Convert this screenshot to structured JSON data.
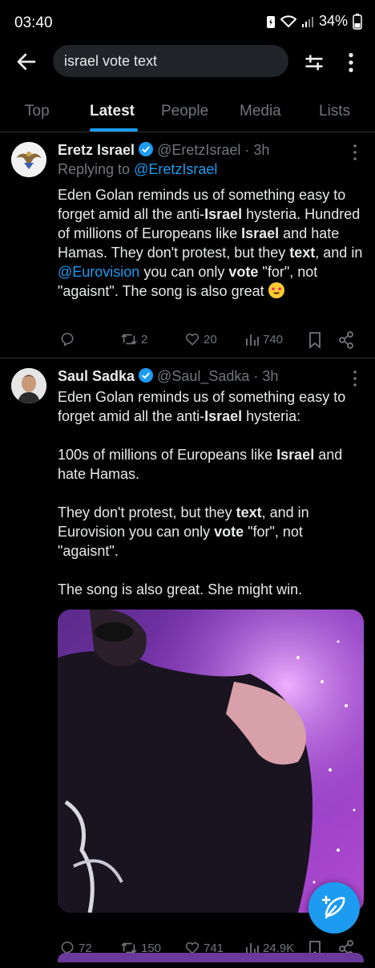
{
  "status_bar": {
    "time": "03:40",
    "battery": "34%"
  },
  "search": {
    "query": "israel vote text"
  },
  "tabs": [
    {
      "label": "Top"
    },
    {
      "label": "Latest"
    },
    {
      "label": "People"
    },
    {
      "label": "Media"
    },
    {
      "label": "Lists"
    }
  ],
  "active_tab": "Latest",
  "tweets": [
    {
      "name": "Eretz Israel",
      "handle": "@EretzIsrael",
      "time": "3h",
      "reply_prefix": "Replying to",
      "reply_handle": "@EretzIsrael",
      "body": {
        "t1": "Eden Golan reminds us of something easy to forget amid all the anti-",
        "b1": "Israel",
        "t2": " hysteria. Hundred of millions of Europeans like ",
        "b2": "Israel",
        "t3": " and hate Hamas. They don't protest, but they ",
        "b3": "text",
        "t4": ", and in ",
        "link": "@Eurovision",
        "t5": " you can only ",
        "b4": "vote",
        "t6": " \"for\", not \"agaisnt\". The song is also great "
      },
      "stats": {
        "reposts": "2",
        "likes": "20",
        "views": "740"
      }
    },
    {
      "name": "Saul Sadka",
      "handle": "@Saul_Sadka",
      "time": "3h",
      "body": {
        "p1a": "Eden Golan reminds us of something easy to forget amid all the anti-",
        "p1b": "Israel",
        "p1c": " hysteria:",
        "p2a": "100s of millions of Europeans like ",
        "p2b": "Israel",
        "p2c": " and hate Hamas.",
        "p3a": "They don't protest, but they ",
        "p3b": "text",
        "p3c": ", and in Eurovision you can only ",
        "p3d": "vote",
        "p3e": " \"for\", not \"agaisnt\".",
        "p4": "The song is also great. She might win."
      },
      "stats": {
        "replies": "72",
        "reposts": "150",
        "likes": "741",
        "views": "24.9K"
      }
    }
  ],
  "colors": {
    "accent": "#1d9bf0",
    "background": "#000000",
    "muted": "#71767b",
    "text": "#e7e9ea"
  },
  "icons": [
    "back-arrow-icon",
    "filter-icon",
    "more-vertical-icon",
    "verified-badge-icon",
    "reply-icon",
    "repost-icon",
    "like-icon",
    "views-icon",
    "bookmark-icon",
    "share-icon",
    "compose-icon",
    "star-struck-emoji"
  ]
}
